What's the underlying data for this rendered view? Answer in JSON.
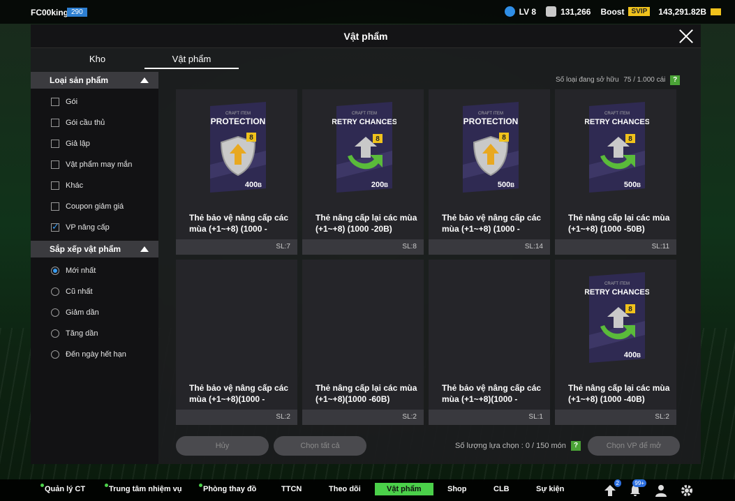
{
  "topbar": {
    "username": "FC00king",
    "user_level_badge": "290",
    "lv": "LV 8",
    "points": "131,266",
    "boost_label": "Boost",
    "svip_label": "SVIP",
    "coins": "143,291.82B"
  },
  "modal": {
    "title": "Vật phẩm",
    "tabs": [
      "Kho",
      "Vật phẩm"
    ],
    "owned_label": "Số loại đang sở hữu",
    "owned_value": "75 / 1.000 cái",
    "help": "?"
  },
  "sidebar": {
    "product_section": "Loại sản phẩm",
    "product_options": [
      {
        "label": "Gói",
        "checked": false
      },
      {
        "label": "Gói cầu thủ",
        "checked": false
      },
      {
        "label": "Giả lập",
        "checked": false
      },
      {
        "label": "Vật phẩm may mắn",
        "checked": false
      },
      {
        "label": "Khác",
        "checked": false
      },
      {
        "label": "Coupon giảm giá",
        "checked": false
      },
      {
        "label": "VP nâng cấp",
        "checked": true
      }
    ],
    "sort_section": "Sắp xếp vật phẩm",
    "sort_options": [
      {
        "label": "Mới nhất",
        "selected": true
      },
      {
        "label": "Cũ nhất",
        "selected": false
      },
      {
        "label": "Giảm dần",
        "selected": false
      },
      {
        "label": "Tăng dần",
        "selected": false
      },
      {
        "label": "Đến ngày hết hạn",
        "selected": false
      }
    ]
  },
  "items": [
    {
      "type": "PROTECTION",
      "amount": "400",
      "name": "Thẻ bảo vệ nâng cấp các mùa (+1~+8) (1000 -",
      "qty": "SL:7",
      "art": true
    },
    {
      "type": "RETRY CHANCES",
      "amount": "200",
      "name": "Thẻ nâng cấp lại các mùa (+1~+8) (1000 -20B)",
      "qty": "SL:8",
      "art": true
    },
    {
      "type": "PROTECTION",
      "amount": "500",
      "name": "Thẻ bảo vệ nâng cấp các mùa (+1~+8) (1000 -",
      "qty": "SL:14",
      "art": true
    },
    {
      "type": "RETRY CHANCES",
      "amount": "500",
      "name": "Thẻ nâng cấp lại các mùa (+1~+8) (1000 -50B)",
      "qty": "SL:11",
      "art": true
    },
    {
      "type": "",
      "amount": "",
      "name": "Thẻ bảo vệ nâng cấp các mùa (+1~+8)(1000 -",
      "qty": "SL:2",
      "art": false
    },
    {
      "type": "",
      "amount": "",
      "name": "Thẻ nâng cấp lại các mùa (+1~+8)(1000 -60B)",
      "qty": "SL:2",
      "art": false
    },
    {
      "type": "",
      "amount": "",
      "name": "Thẻ bảo vệ nâng cấp các mùa (+1~+8)(1000 -",
      "qty": "SL:1",
      "art": false
    },
    {
      "type": "RETRY CHANCES",
      "amount": "400",
      "name": "Thẻ nâng cấp lại các mùa (+1~+8) (1000 -40B)",
      "qty": "SL:2",
      "art": true
    }
  ],
  "card_common": {
    "craft_label": "CRAFT ITEM",
    "tier": "8",
    "unit": "B"
  },
  "actions": {
    "cancel": "Hủy",
    "select_all": "Chọn tất cả",
    "selected_count": "Số lượng lựa chọn : 0 / 150 món",
    "open": "Chọn VP để mở"
  },
  "nav": {
    "items": [
      "Quản lý CT",
      "Trung tâm nhiệm vụ",
      "Phòng thay đồ",
      "TTCN",
      "Theo dõi",
      "Vật phẩm",
      "Shop",
      "CLB",
      "Sự kiện"
    ],
    "badge_1": "2",
    "badge_2": "99+"
  },
  "colors": {
    "accent_blue": "#3a9cf0",
    "active_green": "#4bd04a",
    "gold": "#f0c21c"
  }
}
